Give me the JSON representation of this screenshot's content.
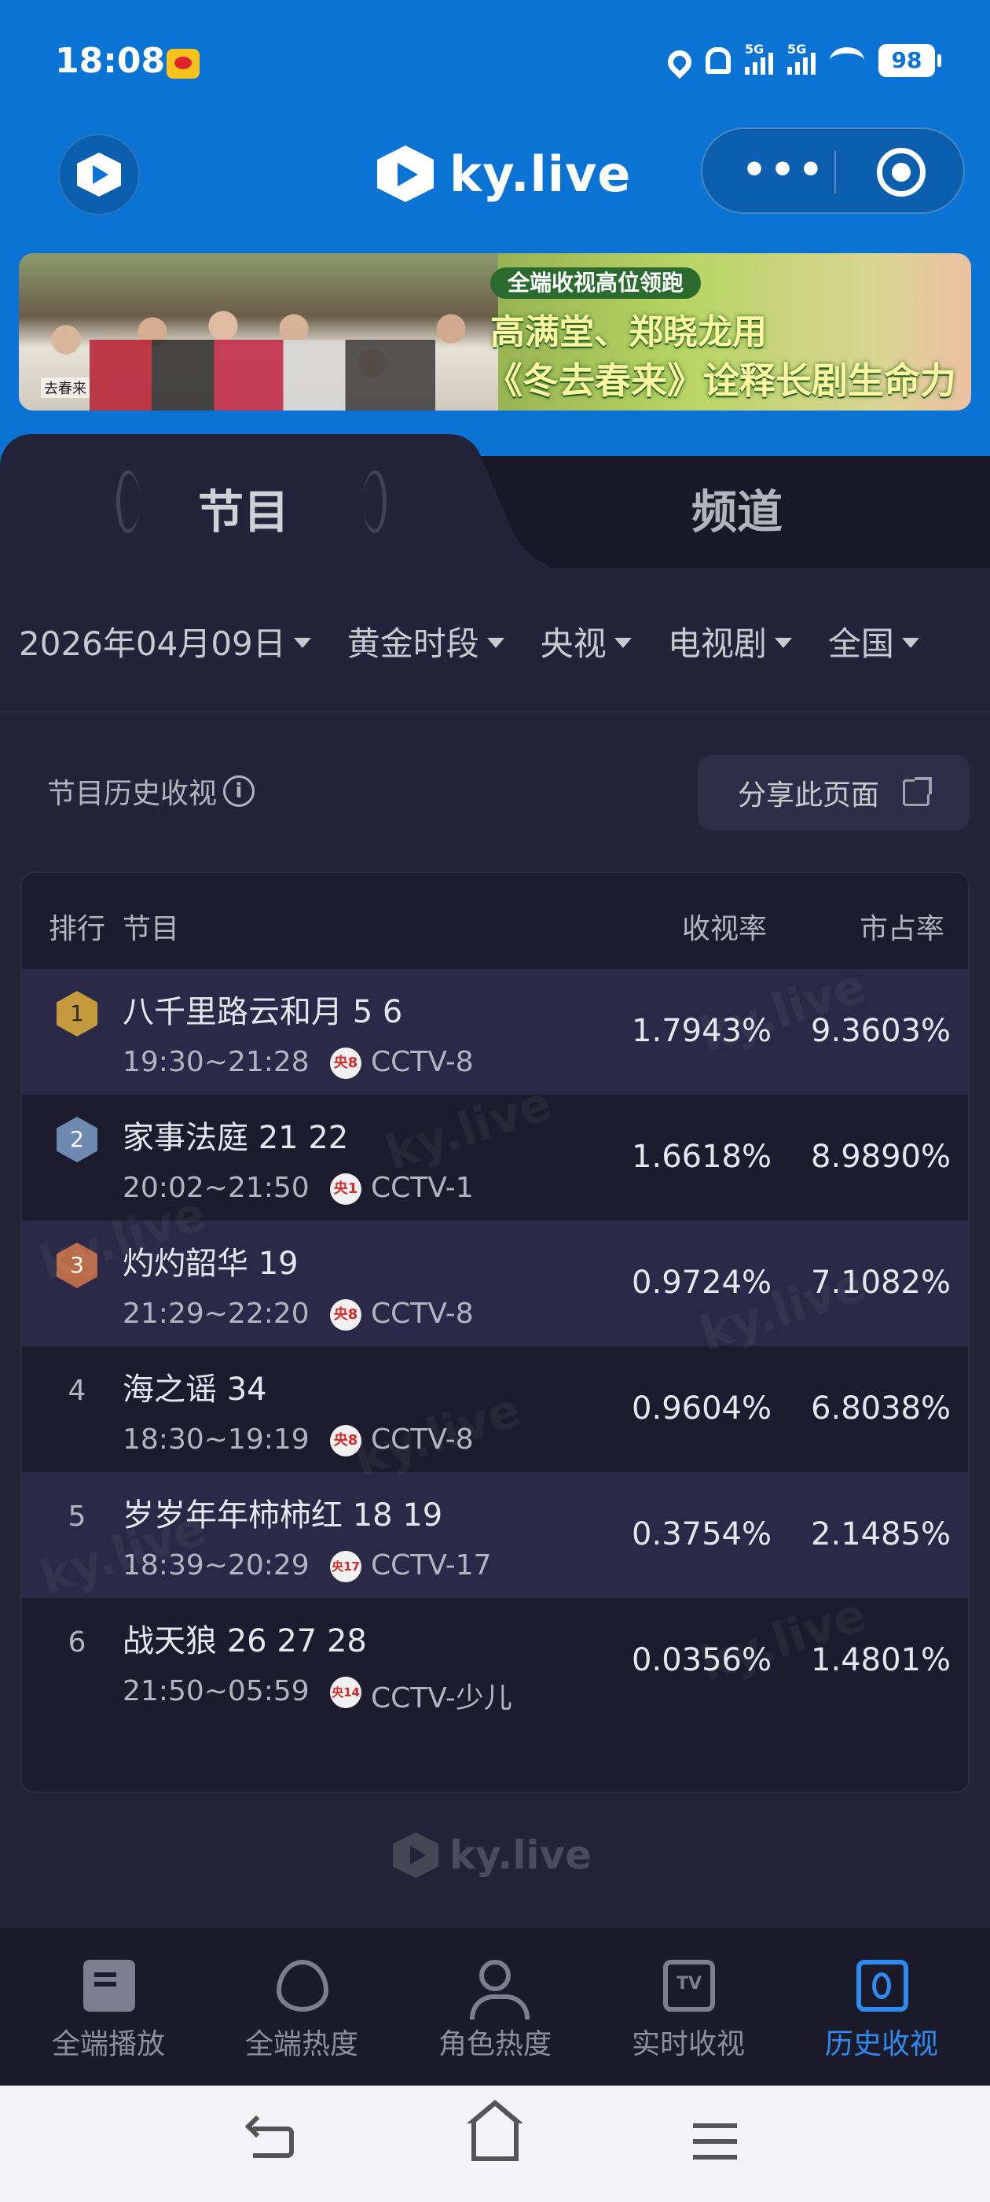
{
  "status_bar": {
    "time": "18:08",
    "battery": "98",
    "signal_1": "5G",
    "signal_2": "5G"
  },
  "header": {
    "brand": "ky.live"
  },
  "banner": {
    "tag": "全端收视高位领跑",
    "line1": "高满堂、郑晓龙用",
    "line2": "《冬去春来》诠释长剧生命力",
    "small_text": "去春来"
  },
  "tabs": [
    {
      "label": "节目",
      "active": true
    },
    {
      "label": "频道",
      "active": false
    }
  ],
  "filters": [
    {
      "label": "2026年04月09日"
    },
    {
      "label": "黄金时段"
    },
    {
      "label": "央视"
    },
    {
      "label": "电视剧"
    },
    {
      "label": "全国"
    }
  ],
  "section": {
    "title": "节目历史收视",
    "info_icon": "i",
    "share_label": "分享此页面"
  },
  "table": {
    "headers": {
      "rank": "排行",
      "program": "节目",
      "rating": "收视率",
      "share": "市占率"
    },
    "rows": [
      {
        "rank": "1",
        "name": "八千里路云和月 5 6",
        "time": "19:30~21:28",
        "logo": "央8",
        "channel": "CCTV-8",
        "rating": "1.7943%",
        "share": "9.3603%"
      },
      {
        "rank": "2",
        "name": "家事法庭 21 22",
        "time": "20:02~21:50",
        "logo": "央1",
        "channel": "CCTV-1",
        "rating": "1.6618%",
        "share": "8.9890%"
      },
      {
        "rank": "3",
        "name": "灼灼韶华 19",
        "time": "21:29~22:20",
        "logo": "央8",
        "channel": "CCTV-8",
        "rating": "0.9724%",
        "share": "7.1082%"
      },
      {
        "rank": "4",
        "name": "海之谣 34",
        "time": "18:30~19:19",
        "logo": "央8",
        "channel": "CCTV-8",
        "rating": "0.9604%",
        "share": "6.8038%"
      },
      {
        "rank": "5",
        "name": "岁岁年年柿柿红 18 19",
        "time": "18:39~20:29",
        "logo": "央17",
        "channel": "CCTV-17",
        "rating": "0.3754%",
        "share": "2.1485%"
      },
      {
        "rank": "6",
        "name": "战天狼 26 27 28",
        "time": "21:50~05:59",
        "logo": "央14",
        "channel": "CCTV-少儿",
        "rating": "0.0356%",
        "share": "1.4801%"
      }
    ]
  },
  "watermark": "ky.live",
  "footer_logo": "ky.live",
  "bottom_tabs": [
    {
      "label": "全端播放",
      "icon": "book-icon",
      "active": false
    },
    {
      "label": "全端热度",
      "icon": "flame-icon",
      "active": false
    },
    {
      "label": "角色热度",
      "icon": "person-icon",
      "active": false
    },
    {
      "label": "实时收视",
      "icon": "tv-icon",
      "icon_text": "TV",
      "active": false
    },
    {
      "label": "历史收视",
      "icon": "history-icon",
      "active": true
    }
  ],
  "colors": {
    "header_blue": "#0a73d3",
    "panel": "#23233a",
    "accent": "#2e8bf0",
    "gold": "#c49a3c",
    "silver": "#6d8ab0",
    "bronze": "#b96a47"
  }
}
